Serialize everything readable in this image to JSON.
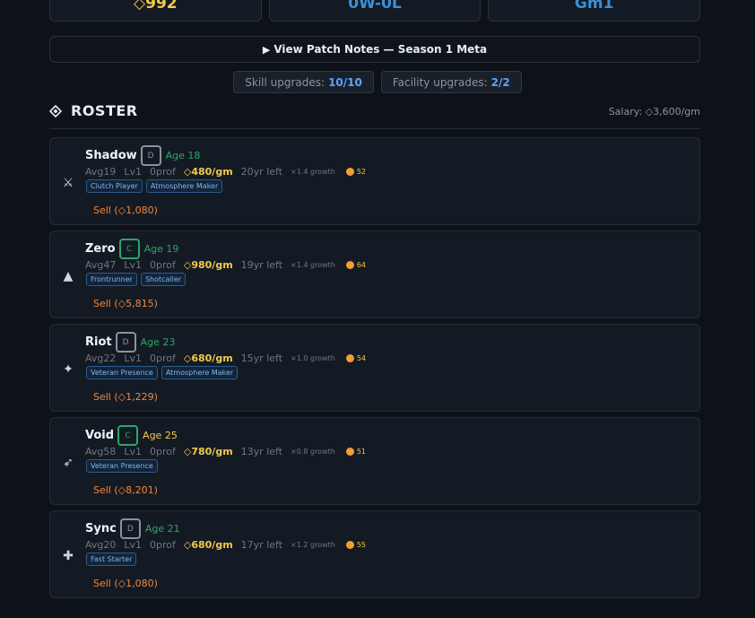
{
  "top_stats": [
    {
      "value": "◇992",
      "color": "gold"
    },
    {
      "value": "0W-0L",
      "color": "blue"
    },
    {
      "value": "Gm1",
      "color": "blue"
    }
  ],
  "patch_notes": {
    "label": "View Patch Notes — Season 1 Meta"
  },
  "upgrades": {
    "skill_label": "Skill upgrades:",
    "skill_value": "10/10",
    "facility_label": "Facility upgrades:",
    "facility_value": "2/2"
  },
  "roster": {
    "title": "ROSTER",
    "salary": "Salary: ◇3,600/gm",
    "players": [
      {
        "icon": "⚔",
        "icon_name": "crossed-swords-icon",
        "name": "Shadow",
        "grade": "D",
        "age": "Age 18",
        "age_color": "green",
        "avg": "Avg19",
        "lvl": "Lv1",
        "prof": "0prof",
        "wage": "◇480/gm",
        "years": "20yr left",
        "growth": "×1.4 growth",
        "mood": "52",
        "traits": [
          "Clutch Player",
          "Atmosphere Maker"
        ],
        "sell": "Sell (◇1,080)"
      },
      {
        "icon": "▲",
        "icon_name": "tree-icon",
        "name": "Zero",
        "grade": "C",
        "age": "Age 19",
        "age_color": "green",
        "avg": "Avg47",
        "lvl": "Lv1",
        "prof": "0prof",
        "wage": "◇980/gm",
        "years": "19yr left",
        "growth": "×1.4 growth",
        "mood": "64",
        "traits": [
          "Frontrunner",
          "Shotcaller"
        ],
        "sell": "Sell (◇5,815)"
      },
      {
        "icon": "✦",
        "icon_name": "sparkle-icon",
        "name": "Riot",
        "grade": "D",
        "age": "Age 23",
        "age_color": "green",
        "avg": "Avg22",
        "lvl": "Lv1",
        "prof": "0prof",
        "wage": "◇680/gm",
        "years": "15yr left",
        "growth": "×1.0 growth",
        "mood": "54",
        "traits": [
          "Veteran Presence",
          "Atmosphere Maker"
        ],
        "sell": "Sell (◇1,229)"
      },
      {
        "icon": "➶",
        "icon_name": "arrow-icon",
        "name": "Void",
        "grade": "C",
        "age": "Age 25",
        "age_color": "gold",
        "avg": "Avg58",
        "lvl": "Lv1",
        "prof": "0prof",
        "wage": "◇780/gm",
        "years": "13yr left",
        "growth": "×0.8 growth",
        "mood": "51",
        "traits": [
          "Veteran Presence"
        ],
        "sell": "Sell (◇8,201)"
      },
      {
        "icon": "✚",
        "icon_name": "medic-cross-icon",
        "name": "Sync",
        "grade": "D",
        "age": "Age 21",
        "age_color": "green",
        "avg": "Avg20",
        "lvl": "Lv1",
        "prof": "0prof",
        "wage": "◇680/gm",
        "years": "17yr left",
        "growth": "×1.2 growth",
        "mood": "55",
        "traits": [
          "Fast Starter"
        ],
        "sell": "Sell (◇1,080)"
      }
    ]
  }
}
